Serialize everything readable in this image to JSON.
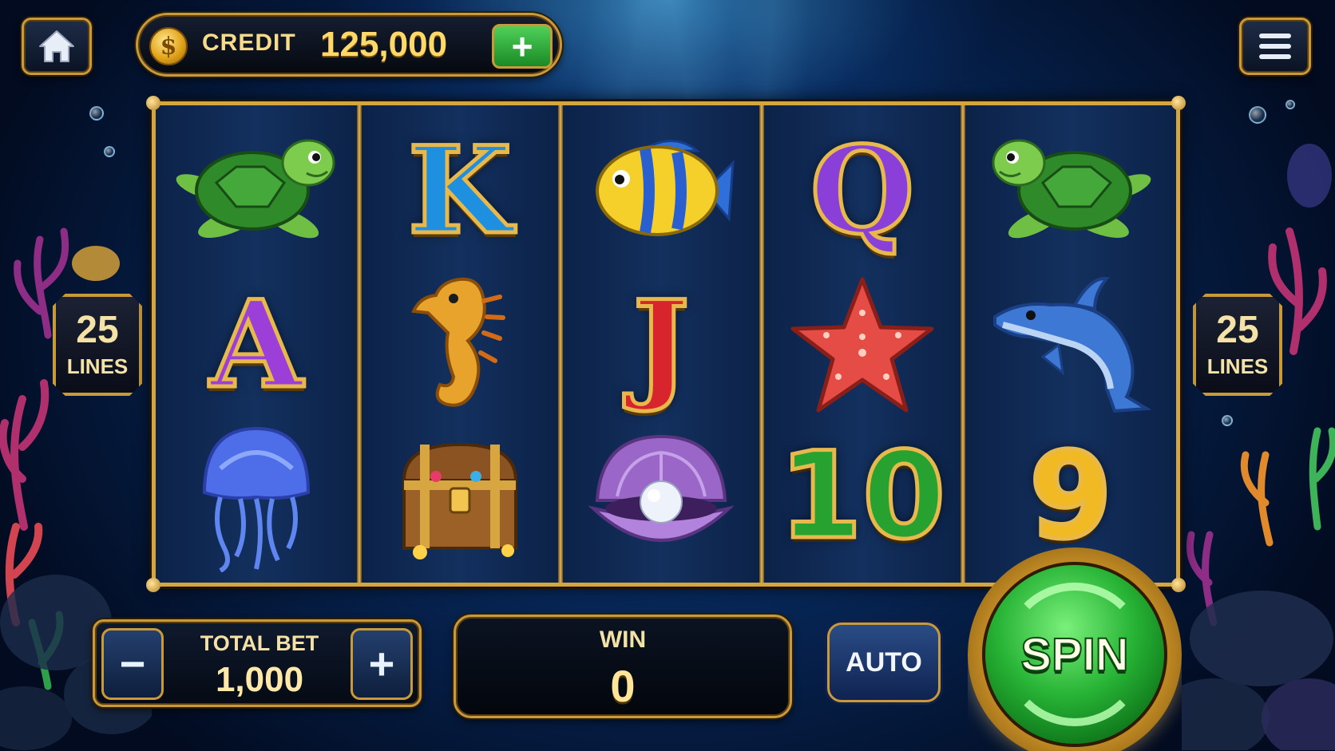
{
  "header": {
    "credit_label": "CREDIT",
    "credit_value": "125,000",
    "coin_symbol": "$",
    "add_credit_symbol": "+"
  },
  "reels": {
    "columns": [
      [
        "turtle",
        "A",
        "jellyfish"
      ],
      [
        "K",
        "seahorse",
        "treasure-chest"
      ],
      [
        "yellow-fish",
        "J",
        "pearl-clam"
      ],
      [
        "Q",
        "starfish",
        "10"
      ],
      [
        "turtle",
        "dolphin",
        "9"
      ]
    ],
    "letter_colors": {
      "A": "#9b3fd8",
      "K": "#1f8fe0",
      "J": "#d8242c",
      "Q": "#8a3fd8",
      "10": "#27a12f",
      "9": "#f1b924"
    }
  },
  "left_lines": {
    "count": "25",
    "label": "LINES"
  },
  "right_lines": {
    "count": "25",
    "label": "LINES"
  },
  "controls": {
    "bet_minus": "−",
    "bet_plus": "+",
    "total_bet_label": "TOTAL BET",
    "total_bet_value": "1,000",
    "win_label": "WIN",
    "win_value": "0",
    "auto_label": "AUTO",
    "spin_label": "SPIN"
  },
  "colors": {
    "gold_frame": "#c99a3a",
    "spin_green": "#27b335",
    "credit_value": "#ffd86a"
  }
}
